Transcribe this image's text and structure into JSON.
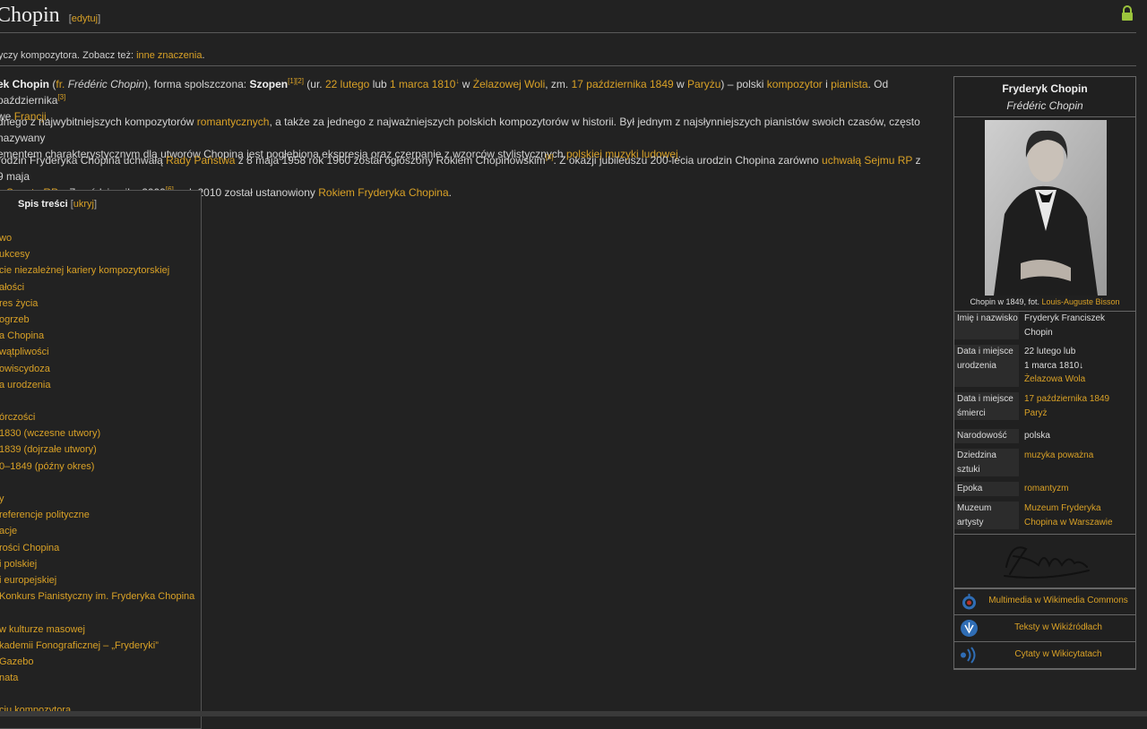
{
  "page": {
    "title": "Chopin",
    "edit_bracket_open": "[",
    "edit_label": "edytuj",
    "edit_bracket_close": "]",
    "hatnote_text": "yczy kompozytora. Zobacz też: ",
    "hatnote_link": "inne znaczenia",
    "hatnote_end": "."
  },
  "para1": {
    "line1": {
      "bold1": "ek Chopin",
      "t1": " (",
      "fr": "fr.",
      "t2": " ",
      "fr_name": "Frédéric Chopin",
      "t3": "), forma spolszczona: ",
      "bold2": "Szopen",
      "ref1": "[1]",
      "ref2": "[2]",
      "t4": " (ur. ",
      "date1": "22 lutego",
      "t5": " lub ",
      "date2": "1 marca 1810",
      "note": "↓",
      "t6": " w ",
      "place1": "Żelazowej Woli",
      "t7": ", zm. ",
      "date3": "17 października 1849",
      "t8": " w ",
      "place2": "Paryżu",
      "t9": ") – polski ",
      "job1": "kompozytor",
      "t10": " i ",
      "job2": "pianista",
      "t11": ". Od października",
      "ref3": "[3]"
    },
    "line2": {
      "t1": " we ",
      "link": "Francji",
      "t2": "."
    }
  },
  "para2": {
    "line1": {
      "t1": "dnego z najwybitniejszych kompozytorów ",
      "link": "romantycznych",
      "t2": ", a także za jednego z najważniejszych polskich kompozytorów w historii. Był jednym z najsłynniejszych pianistów swoich czasów, często nazywany"
    },
    "line2": {
      "t1": "ementem charakterystycznym dla utworów Chopina jest pogłębiona ekspresja oraz czerpanie z wzorców stylistycznych ",
      "link": "polskiej muzyki ludowej",
      "t2": "."
    }
  },
  "para3": {
    "line1": {
      "t1": "rodzin Fryderyka Chopina uchwałą ",
      "link1": "Rady Państwa",
      "t2": " z 8 maja 1958 rok 1960 został ogłoszony Rokiem Chopinowskim",
      "ref": "[4]",
      "t3": ". Z okazji jubileuszu 200-lecia urodzin Chopina zarówno ",
      "link2": "uchwałą Sejmu RP",
      "t4": " z 9 maja"
    },
    "line2": {
      "link1": "ą Senatu RP",
      "t1": " z 7 października 2009",
      "ref": "[6]",
      "t2": ", rok 2010 został ustanowiony ",
      "link2": "Rokiem Fryderyka Chopina",
      "t3": "."
    }
  },
  "toc": {
    "title": "Spis treści",
    "hide_open": " [",
    "hide_label": "ukryj",
    "hide_close": "]",
    "items": [
      "wo",
      "ukcesy",
      "cie niezależnej kariery kompozytorskiej",
      "ałości",
      "res życia",
      "ogrzeb",
      "a Chopina",
      "wątpliwości",
      "owiscydoza",
      "a urodzenia",
      "",
      "órczości",
      "1830 (wczesne utwory)",
      "1839 (dojrzałe utwory)",
      "0–1849 (późny okres)",
      "",
      "y",
      "referencje polityczne",
      "acje",
      "rości Chopina",
      "i polskiej",
      "i europejskiej",
      " Konkurs Pianistyczny im. Fryderyka Chopina",
      "",
      "w kulturze masowej",
      "kademii Fonograficznej – „Fryderyki”",
      "Gazebo",
      "nata",
      "",
      "ciu kompozytora"
    ]
  },
  "infobox": {
    "name": "Fryderyk Chopin",
    "original_name": "Frédéric Chopin",
    "caption_text": "Chopin w 1849, fot. ",
    "caption_link": "Louis-Auguste Bisson",
    "rows": [
      {
        "label": "Imię i nazwisko",
        "value_lines": [
          "Fryderyk Franciszek",
          "Chopin"
        ]
      },
      {
        "label": "Data i miejsce urodzenia",
        "value_lines": [
          "22 lutego lub",
          "1 marca 1810↓"
        ],
        "value_link": "Żelazowa Wola"
      },
      {
        "label": "Data i miejsce śmierci",
        "value_link_lines": [
          "17 października 1849",
          "Paryż"
        ]
      },
      {
        "label": "Narodowość",
        "value_lines": [
          "polska"
        ]
      },
      {
        "label": "Dziedzina sztuki",
        "value_link_lines": [
          "muzyka poważna"
        ]
      },
      {
        "label": "Epoka",
        "value_link_lines": [
          "romantyzm"
        ]
      },
      {
        "label": "Muzeum artysty",
        "value_link_lines": [
          "Muzeum Fryderyka",
          "Chopina w Warszawie"
        ]
      }
    ],
    "links": [
      {
        "label": "Multimedia w Wikimedia Commons",
        "icon": "wikimedia-commons-icon"
      },
      {
        "label": "Teksty w Wikiźródłach",
        "icon": "wikisource-icon"
      },
      {
        "label": "Cytaty w Wikicytatach",
        "icon": "wikiquote-icon"
      }
    ]
  },
  "colors": {
    "background": "#222222",
    "link": "#d9a126",
    "text": "#d8d8d8",
    "border": "#666666"
  }
}
